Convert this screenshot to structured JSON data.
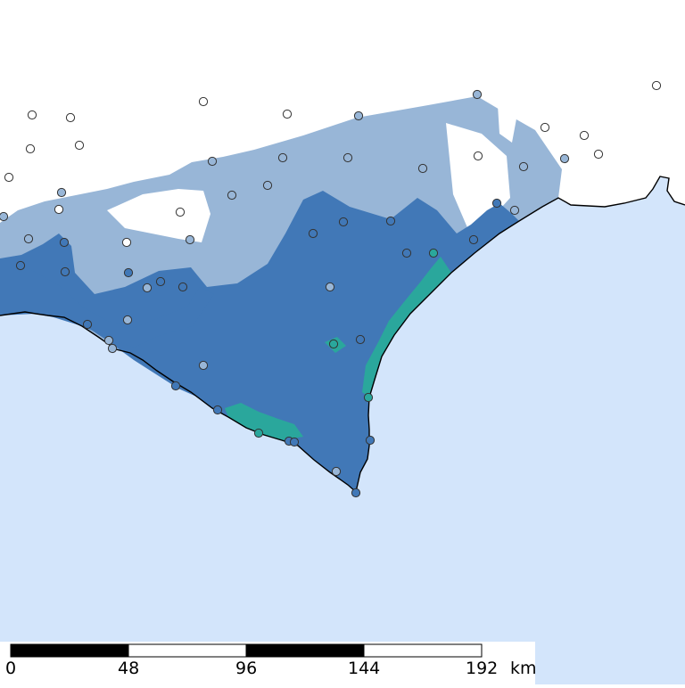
{
  "map": {
    "colors": {
      "sea": "#d3e5fb",
      "land": "#ffffff",
      "zone_light": "#98b6d7",
      "zone_medium": "#4178b7",
      "zone_teal": "#2aa79c",
      "coast_line": "#000000",
      "marker_stroke": "#333333"
    },
    "legend_note": "",
    "markers": [
      {
        "lon": 36,
        "lat": 129,
        "cls": "none"
      },
      {
        "lon": 79,
        "lat": 132,
        "cls": "none"
      },
      {
        "lon": 34,
        "lat": 167,
        "cls": "none"
      },
      {
        "lon": 89,
        "lat": 163,
        "cls": "none"
      },
      {
        "lon": 10,
        "lat": 199,
        "cls": "none"
      },
      {
        "lon": 228,
        "lat": 114,
        "cls": "none"
      },
      {
        "lon": 322,
        "lat": 128,
        "cls": "none"
      },
      {
        "lon": 402,
        "lat": 130,
        "cls": "light"
      },
      {
        "lon": 535,
        "lat": 106,
        "cls": "light"
      },
      {
        "lon": 736,
        "lat": 96,
        "cls": "none"
      },
      {
        "lon": 611,
        "lat": 143,
        "cls": "none"
      },
      {
        "lon": 655,
        "lat": 152,
        "cls": "none"
      },
      {
        "lon": 671,
        "lat": 173,
        "cls": "none"
      },
      {
        "lon": 633,
        "lat": 178,
        "cls": "light"
      },
      {
        "lon": 536,
        "lat": 175,
        "cls": "none"
      },
      {
        "lon": 587,
        "lat": 187,
        "cls": "light"
      },
      {
        "lon": 474,
        "lat": 189,
        "cls": "light"
      },
      {
        "lon": 390,
        "lat": 177,
        "cls": "light"
      },
      {
        "lon": 317,
        "lat": 177,
        "cls": "light"
      },
      {
        "lon": 238,
        "lat": 181,
        "cls": "light"
      },
      {
        "lon": 300,
        "lat": 208,
        "cls": "light"
      },
      {
        "lon": 260,
        "lat": 219,
        "cls": "light"
      },
      {
        "lon": 69,
        "lat": 216,
        "cls": "light"
      },
      {
        "lon": 66,
        "lat": 235,
        "cls": "none"
      },
      {
        "lon": 4,
        "lat": 243,
        "cls": "light"
      },
      {
        "lon": 202,
        "lat": 238,
        "cls": "none"
      },
      {
        "lon": 213,
        "lat": 269,
        "cls": "light"
      },
      {
        "lon": 142,
        "lat": 272,
        "cls": "none"
      },
      {
        "lon": 32,
        "lat": 268,
        "cls": "light"
      },
      {
        "lon": 72,
        "lat": 272,
        "cls": "medium"
      },
      {
        "lon": 23,
        "lat": 298,
        "cls": "medium"
      },
      {
        "lon": 73,
        "lat": 305,
        "cls": "medium"
      },
      {
        "lon": 144,
        "lat": 306,
        "cls": "medium"
      },
      {
        "lon": 180,
        "lat": 316,
        "cls": "medium"
      },
      {
        "lon": 165,
        "lat": 323,
        "cls": "light"
      },
      {
        "lon": 205,
        "lat": 322,
        "cls": "medium"
      },
      {
        "lon": 351,
        "lat": 262,
        "cls": "medium"
      },
      {
        "lon": 385,
        "lat": 249,
        "cls": "medium"
      },
      {
        "lon": 438,
        "lat": 248,
        "cls": "medium"
      },
      {
        "lon": 557,
        "lat": 228,
        "cls": "medium"
      },
      {
        "lon": 577,
        "lat": 236,
        "cls": "light"
      },
      {
        "lon": 531,
        "lat": 269,
        "cls": "medium"
      },
      {
        "lon": 456,
        "lat": 284,
        "cls": "medium"
      },
      {
        "lon": 486,
        "lat": 284,
        "cls": "teal"
      },
      {
        "lon": 370,
        "lat": 322,
        "cls": "light"
      },
      {
        "lon": 98,
        "lat": 364,
        "cls": "medium"
      },
      {
        "lon": 143,
        "lat": 359,
        "cls": "light"
      },
      {
        "lon": 122,
        "lat": 382,
        "cls": "light"
      },
      {
        "lon": 126,
        "lat": 391,
        "cls": "light"
      },
      {
        "lon": 374,
        "lat": 386,
        "cls": "teal"
      },
      {
        "lon": 404,
        "lat": 381,
        "cls": "medium"
      },
      {
        "lon": 228,
        "lat": 410,
        "cls": "light"
      },
      {
        "lon": 197,
        "lat": 433,
        "cls": "medium"
      },
      {
        "lon": 413,
        "lat": 446,
        "cls": "teal"
      },
      {
        "lon": 244,
        "lat": 460,
        "cls": "medium"
      },
      {
        "lon": 290,
        "lat": 486,
        "cls": "teal"
      },
      {
        "lon": 324,
        "lat": 495,
        "cls": "medium"
      },
      {
        "lon": 330,
        "lat": 496,
        "cls": "medium"
      },
      {
        "lon": 415,
        "lat": 494,
        "cls": "medium"
      },
      {
        "lon": 377,
        "lat": 529,
        "cls": "light"
      },
      {
        "lon": 399,
        "lat": 553,
        "cls": "medium"
      }
    ]
  },
  "scale": {
    "ticks": [
      "0",
      "48",
      "96",
      "144",
      "192"
    ],
    "unit": "km"
  }
}
